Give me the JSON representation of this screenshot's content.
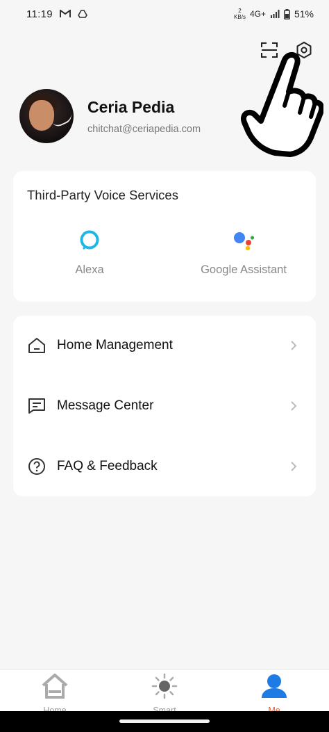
{
  "status_bar": {
    "time": "11:19",
    "net_rate_value": "2",
    "net_rate_unit": "KB/s",
    "network": "4G+",
    "battery": "51%"
  },
  "top_actions": {
    "scan_icon": "scan-icon",
    "settings_icon": "gear-icon"
  },
  "profile": {
    "name": "Ceria Pedia",
    "email": "chitchat@ceriapedia.com"
  },
  "voice_services": {
    "title": "Third-Party Voice Services",
    "items": [
      {
        "label": "Alexa",
        "icon": "alexa-icon"
      },
      {
        "label": "Google Assistant",
        "icon": "google-assistant-icon"
      }
    ]
  },
  "menu": {
    "items": [
      {
        "label": "Home Management",
        "icon": "home-icon"
      },
      {
        "label": "Message Center",
        "icon": "message-icon"
      },
      {
        "label": "FAQ & Feedback",
        "icon": "question-icon"
      }
    ]
  },
  "tab_bar": {
    "tabs": [
      {
        "label": "Home",
        "icon": "home-tab-icon",
        "active": false
      },
      {
        "label": "Smart",
        "icon": "sun-icon",
        "active": false
      },
      {
        "label": "Me",
        "icon": "person-icon",
        "active": true
      }
    ]
  },
  "colors": {
    "accent": "#e8592b",
    "active_tab_icon": "#1e7be4",
    "background": "#f6f6f6"
  }
}
